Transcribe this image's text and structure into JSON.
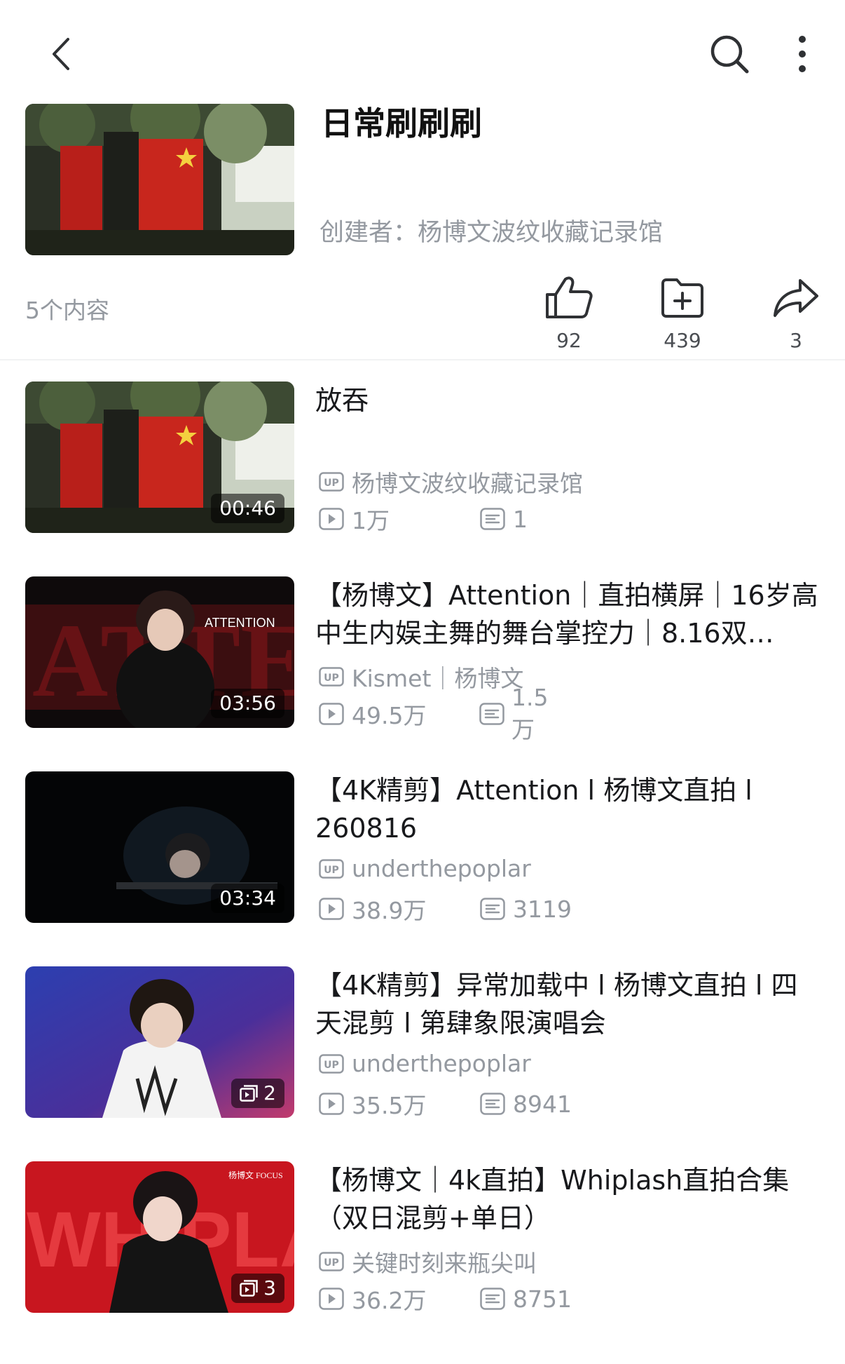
{
  "header": {
    "title": "日常刷刷刷",
    "creator": "创建者：杨博文波纹收藏记录馆",
    "content_count": "5个内容",
    "like_count": "92",
    "fav_count": "439",
    "share_count": "3"
  },
  "icons": {
    "back": "chevron-left-icon",
    "search": "search-icon",
    "more": "more-vertical-icon",
    "like": "thumbs-up-icon",
    "fav": "add-to-folder-icon",
    "share": "share-arrow-icon",
    "up": "up-badge-icon",
    "play": "play-count-icon",
    "danmaku": "danmaku-icon"
  },
  "items": [
    {
      "title": "放吞",
      "uploader": "杨博文波纹收藏记录馆",
      "views": "1万",
      "danmaku": "1",
      "badge": "00:46",
      "badge_type": "duration"
    },
    {
      "title": "【杨博文】Attention｜直拍横屏｜16岁高中生内娱主舞的舞台掌控力｜8.16双…",
      "uploader": "Kismet｜杨博文",
      "views": "49.5万",
      "danmaku": "1.5万",
      "badge": "03:56",
      "badge_type": "duration"
    },
    {
      "title": "【4K精剪】Attention l 杨博文直拍 l 260816",
      "uploader": "underthepoplar",
      "views": "38.9万",
      "danmaku": "3119",
      "badge": "03:34",
      "badge_type": "duration"
    },
    {
      "title": "【4K精剪】异常加载中 l 杨博文直拍 l 四天混剪 l 第肆象限演唱会",
      "uploader": "underthepoplar",
      "views": "35.5万",
      "danmaku": "8941",
      "badge": "2",
      "badge_type": "parts"
    },
    {
      "title": "【杨博文｜4k直拍】Whiplash直拍合集（双日混剪+单日）",
      "uploader": "关键时刻来瓶尖叫",
      "views": "36.2万",
      "danmaku": "8751",
      "badge": "3",
      "badge_type": "parts"
    }
  ],
  "thumb_text": {
    "attention": "ATTENTION",
    "whiplash": "WHIPLASH",
    "focus": "杨博文 FOCUS"
  }
}
